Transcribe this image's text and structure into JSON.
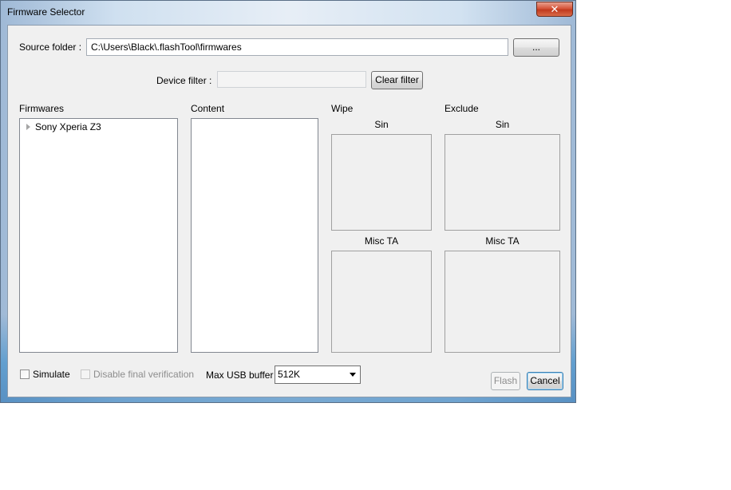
{
  "window": {
    "title": "Firmware Selector"
  },
  "source": {
    "label": "Source folder :",
    "path": "C:\\Users\\Black\\.flashTool\\firmwares",
    "browse_label": "..."
  },
  "filter": {
    "label": "Device filter :",
    "value": "",
    "clear_label": "Clear filter"
  },
  "firmwares": {
    "header": "Firmwares",
    "items": [
      {
        "label": "Sony Xperia Z3"
      }
    ]
  },
  "content": {
    "header": "Content"
  },
  "wipe": {
    "header": "Wipe",
    "sin_label": "Sin",
    "misc_label": "Misc TA"
  },
  "exclude": {
    "header": "Exclude",
    "sin_label": "Sin",
    "misc_label": "Misc TA"
  },
  "options": {
    "simulate_label": "Simulate",
    "disable_verif_label": "Disable final verification",
    "usb_buffer_label": "Max USB buffer",
    "usb_buffer_value": "512K"
  },
  "actions": {
    "flash_label": "Flash",
    "cancel_label": "Cancel"
  },
  "icons": {
    "close": "close-icon",
    "expand": "expand-triangle-icon",
    "dropdown": "chevron-down-icon"
  }
}
